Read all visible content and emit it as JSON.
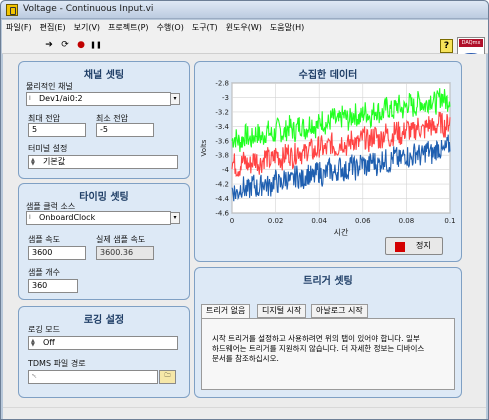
{
  "window": {
    "title": "Voltage - Continuous Input.vi"
  },
  "menu": [
    "파일(F)",
    "편집(E)",
    "보기(V)",
    "프로젝트(P)",
    "수행(O)",
    "도구(T)",
    "윈도우(W)",
    "도움말(H)"
  ],
  "toolbar": {
    "run": "➔",
    "run_cont": "⟳",
    "abort": "●",
    "pause": "❚❚",
    "help": "?",
    "logo_text": "DAQmx"
  },
  "channel": {
    "title": "채널 셋팅",
    "physical_label": "물리적인 채널",
    "physical_value": "Dev1/ai0:2",
    "max_label": "최대 전압",
    "max_value": "5",
    "min_label": "최소 전압",
    "min_value": "-5",
    "terminal_label": "터미널 설정",
    "terminal_value": "기본값"
  },
  "timing": {
    "title": "타이밍 셋팅",
    "clock_label": "샘플 클럭 소스",
    "clock_value": "OnboardClock",
    "rate_label": "샘플 속도",
    "rate_value": "3600",
    "actual_label": "실제 샘플 속도",
    "actual_value": "3600.36",
    "count_label": "샘플 개수",
    "count_value": "360"
  },
  "logging": {
    "title": "로깅 설정",
    "mode_label": "로깅 모드",
    "mode_value": "Off",
    "path_label": "TDMS 파일 경로",
    "path_value": "␀"
  },
  "data": {
    "title": "수집한 데이터",
    "stop_label": "정지"
  },
  "trigger": {
    "title": "트리거 셋팅",
    "tabs": [
      "트리거 없음",
      "디지털 시작",
      "아날로그 시작"
    ],
    "message_line1": "시작 트리거를 설정하고 사용하려면 위의 탭이 있어야 합니다.  일부",
    "message_line2": "하드웨어는 트리거를 지원하지 않습니다. 더 자세한 정보는 디바이스",
    "message_line3": "문서를 참조하십시오."
  },
  "chart_data": {
    "type": "line",
    "title": "",
    "xlabel": "시간",
    "ylabel": "Volts",
    "xlim": [
      0,
      0.1
    ],
    "ylim": [
      -4.6,
      -2.8
    ],
    "xticks": [
      "0",
      "0.02",
      "0.04",
      "0.06",
      "0.08",
      "0.1"
    ],
    "yticks": [
      "-2.8",
      "-3",
      "-3.2",
      "-3.4",
      "-3.6",
      "-3.8",
      "-4",
      "-4.2",
      "-4.4",
      "-4.6"
    ],
    "grid": true,
    "series": [
      {
        "color": "#22ff22",
        "values": [
          [
            0,
            -3.6
          ],
          [
            0.1,
            -3.0
          ]
        ]
      },
      {
        "color": "#ff4444",
        "values": [
          [
            0,
            -3.95
          ],
          [
            0.1,
            -3.35
          ]
        ]
      },
      {
        "color": "#1f5fb0",
        "values": [
          [
            0,
            -4.3
          ],
          [
            0.1,
            -3.7
          ]
        ]
      }
    ]
  }
}
